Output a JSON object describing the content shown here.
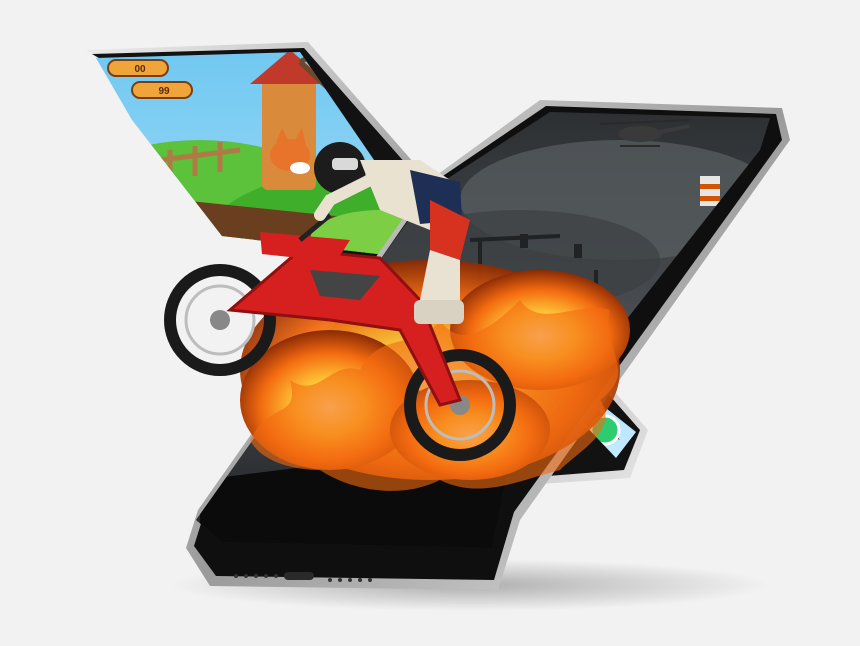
{
  "image": {
    "background_color": "#f2f2f2",
    "subjects": [
      "back-phone-cartoon-game",
      "front-phone-dark-war-game",
      "dirt-bike-rider",
      "fire-explosion",
      "helicopter"
    ],
    "hud": {
      "score_left": "00",
      "score_top": "99"
    },
    "colors": {
      "phone_frame": "#111111",
      "phone_bezel_metal": "#cfcfcf",
      "bike_red": "#d61f1f",
      "fire_orange": "#f36b10",
      "fire_yellow": "#ffc637",
      "sky_cartoon": "#86d3f5",
      "grass_green": "#3fae2a",
      "storm_sky": "#3a3d40"
    }
  }
}
